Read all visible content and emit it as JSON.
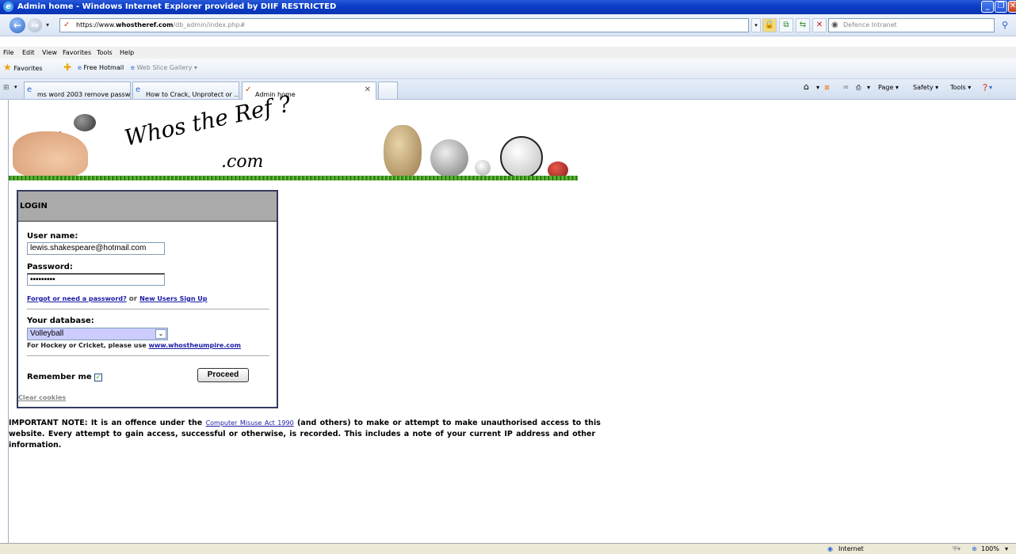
{
  "window": {
    "title": "Admin home - Windows Internet Explorer provided by DIIF RESTRICTED"
  },
  "address": {
    "proto": "https://www.",
    "host": "whostheref.com",
    "path": "/db_admin/index.php#"
  },
  "search": {
    "placeholder": "Defence Intranet"
  },
  "menu": [
    "File",
    "Edit",
    "View",
    "Favorites",
    "Tools",
    "Help"
  ],
  "favorites": {
    "label": "Favorites",
    "items": [
      "Free Hotmail",
      "Web Slice Gallery ▾"
    ]
  },
  "tabs": [
    {
      "label": "ms word 2003 remove passw..."
    },
    {
      "label": "How to Crack, Unprotect or ..."
    },
    {
      "label": "Admin home"
    }
  ],
  "commands": {
    "page": "Page ▾",
    "safety": "Safety ▾",
    "tools": "Tools ▾"
  },
  "logo": {
    "line1": "Whos the Ref ?",
    "line2": ".com"
  },
  "login": {
    "header": "LOGIN",
    "username_label": "User name:",
    "username_value": "lewis.shakespeare@hotmail.com",
    "password_label": "Password:",
    "password_mask": "•••••••••",
    "forgot_link": "Forgot or need a password?",
    "or_text": "or",
    "signup_link": "New Users Sign Up",
    "database_label": "Your database:",
    "database_value": "Volleyball",
    "hockey_text": "For Hockey or Cricket, please use",
    "hockey_link": "www.whostheumpire.com",
    "remember_label": "Remember me",
    "proceed_label": "Proceed",
    "clear_cookies": "Clear cookies"
  },
  "note": {
    "prefix": "IMPORTANT NOTE: It is an offence under the",
    "link": "Computer Misuse Act 1990",
    "suffix": "(and others) to make or attempt to make unauthorised access to this website. Every attempt to gain access, successful or otherwise, is recorded. This includes a note of your current IP address and other information."
  },
  "status": {
    "zone": "Internet",
    "zoom": "100%"
  }
}
